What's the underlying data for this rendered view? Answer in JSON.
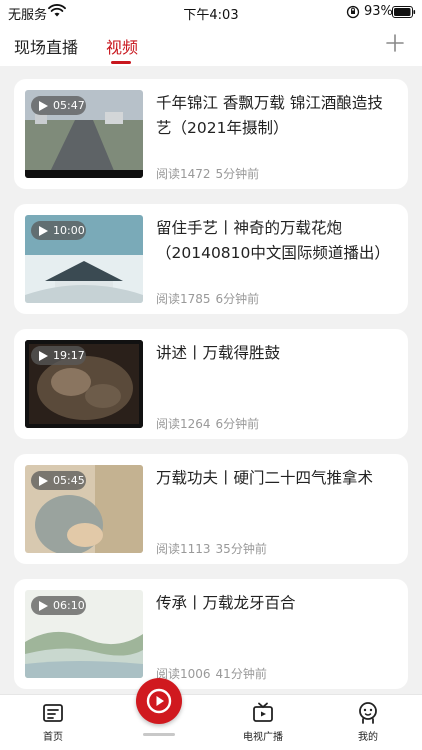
{
  "status": {
    "carrier": "无服务",
    "time": "下午4:03",
    "battery": "93%"
  },
  "tabs": [
    {
      "label": "现场直播"
    },
    {
      "label": "视频"
    }
  ],
  "videos": [
    {
      "duration": "05:47",
      "title": "千年锦江 香飘万载 锦江酒酿造技艺（2021年摄制）",
      "reads": "阅读1472",
      "ago": "5分钟前"
    },
    {
      "duration": "10:00",
      "title": "留住手艺丨神奇的万载花炮（20140810中文国际频道播出）",
      "reads": "阅读1785",
      "ago": "6分钟前"
    },
    {
      "duration": "19:17",
      "title": "讲述丨万载得胜鼓",
      "reads": "阅读1264",
      "ago": "6分钟前"
    },
    {
      "duration": "05:45",
      "title": "万载功夫丨硬门二十四气推拿术",
      "reads": "阅读1113",
      "ago": "35分钟前"
    },
    {
      "duration": "06:10",
      "title": "传承丨万载龙牙百合",
      "reads": "阅读1006",
      "ago": "41分钟前"
    }
  ],
  "nav": {
    "home": "首页",
    "tv": "电视广播",
    "mine": "我的"
  },
  "colors": {
    "accent": "#c8161d",
    "background": "#f1f1f1"
  }
}
